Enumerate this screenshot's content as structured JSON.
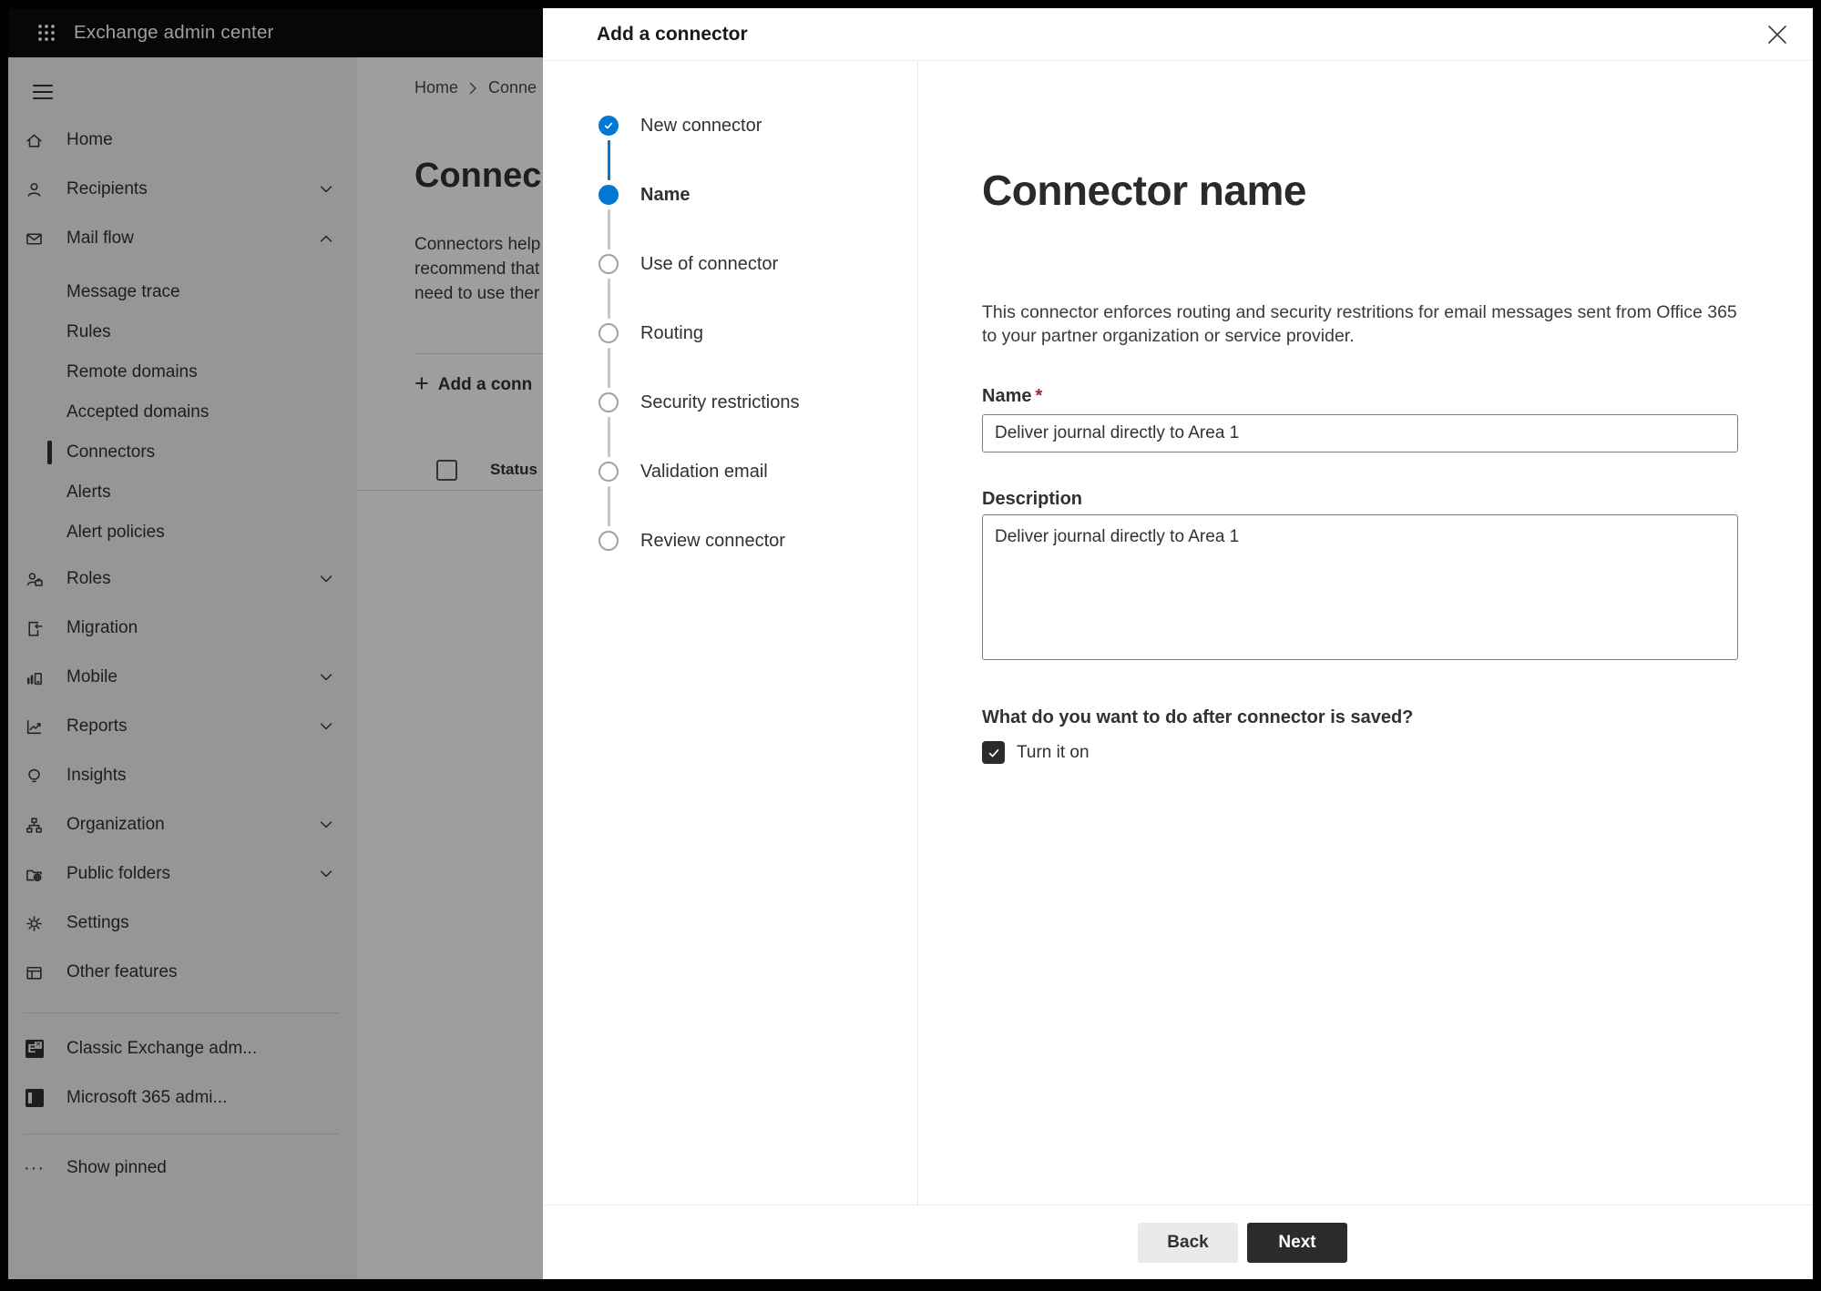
{
  "topbar": {
    "title": "Exchange admin center"
  },
  "sidebar": {
    "items": [
      {
        "label": "Home",
        "icon": "home-icon"
      },
      {
        "label": "Recipients",
        "icon": "person-icon",
        "chevron": "down"
      },
      {
        "label": "Mail flow",
        "icon": "mail-icon",
        "chevron": "up"
      },
      {
        "label": "Message trace",
        "sub": true
      },
      {
        "label": "Rules",
        "sub": true
      },
      {
        "label": "Remote domains",
        "sub": true
      },
      {
        "label": "Accepted domains",
        "sub": true
      },
      {
        "label": "Connectors",
        "sub": true,
        "selected": true
      },
      {
        "label": "Alerts",
        "sub": true
      },
      {
        "label": "Alert policies",
        "sub": true
      },
      {
        "label": "Roles",
        "icon": "roles-icon",
        "chevron": "down"
      },
      {
        "label": "Migration",
        "icon": "migration-icon"
      },
      {
        "label": "Mobile",
        "icon": "mobile-icon",
        "chevron": "down"
      },
      {
        "label": "Reports",
        "icon": "reports-icon",
        "chevron": "down"
      },
      {
        "label": "Insights",
        "icon": "insights-icon"
      },
      {
        "label": "Organization",
        "icon": "organization-icon",
        "chevron": "down"
      },
      {
        "label": "Public folders",
        "icon": "public-folders-icon",
        "chevron": "down"
      },
      {
        "label": "Settings",
        "icon": "settings-icon"
      },
      {
        "label": "Other features",
        "icon": "other-features-icon"
      },
      {
        "label": "Classic Exchange adm...",
        "icon": "classic-exchange-icon"
      },
      {
        "label": "Microsoft 365 admi...",
        "icon": "microsoft-365-icon"
      },
      {
        "label": "Show pinned",
        "icon": "more-icon"
      }
    ]
  },
  "page": {
    "breadcrumb": {
      "home": "Home",
      "current": "Conne"
    },
    "title_fragment": "Connec",
    "intro_lines": [
      "Connectors help",
      "recommend that",
      "need to use ther"
    ],
    "add_connector_label": "Add a conn",
    "status_column": "Status"
  },
  "modal": {
    "title": "Add a connector",
    "steps": [
      {
        "label": "New connector",
        "state": "completed"
      },
      {
        "label": "Name",
        "state": "current"
      },
      {
        "label": "Use of connector",
        "state": "upcoming"
      },
      {
        "label": "Routing",
        "state": "upcoming"
      },
      {
        "label": "Security restrictions",
        "state": "upcoming"
      },
      {
        "label": "Validation email",
        "state": "upcoming"
      },
      {
        "label": "Review connector",
        "state": "upcoming"
      }
    ],
    "content": {
      "heading": "Connector name",
      "description_lines": [
        "This connector enforces routing and security restritions for email messages sent from Office 365",
        "to your partner organization or service provider."
      ],
      "name_label": "Name",
      "required_marker": "*",
      "name_value": "Deliver journal directly to Area 1",
      "description_label": "Description",
      "description_value": "Deliver journal directly to Area 1",
      "after_save_question": "What do you want to do after connector is saved?",
      "turn_on_label": "Turn it on",
      "turn_on_checked": true
    },
    "footer": {
      "back": "Back",
      "next": "Next"
    }
  },
  "colors": {
    "accent": "#0078d4",
    "primary_button": "#2b2b2b",
    "checkbox_checked": "#2b2b2b",
    "required_asterisk": "#a4262c",
    "overlay": "rgba(0,0,0,0.38)"
  }
}
